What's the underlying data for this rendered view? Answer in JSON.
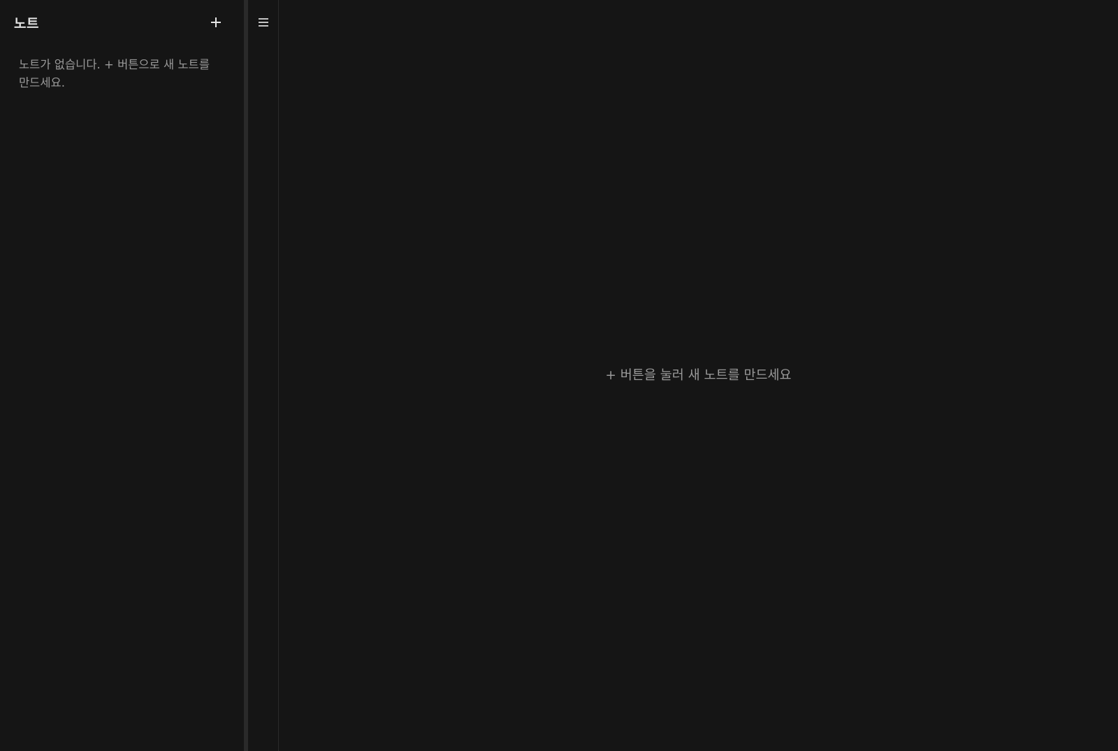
{
  "sidebar": {
    "title": "노트",
    "add_icon": "plus-icon",
    "empty_message": "노트가 없습니다. + 버튼으로 새 노트를 만드세요."
  },
  "toolbar": {
    "menu_icon": "hamburger-menu-icon"
  },
  "main": {
    "empty_message": "+ 버튼을 눌러 새 노트를 만드세요"
  },
  "colors": {
    "background": "#151515",
    "splitter": "#2a2a2a",
    "title_text": "#e2e2e2",
    "muted_text": "#9a9a9a"
  }
}
